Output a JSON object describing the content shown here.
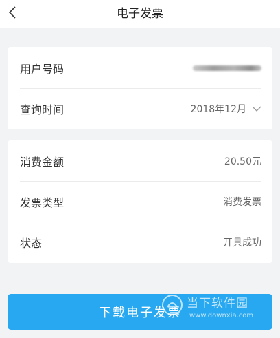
{
  "nav": {
    "title": "电子发票",
    "back_icon": "chevron-left-icon"
  },
  "query_card": {
    "user_number": {
      "label": "用户号码",
      "value_redacted": true
    },
    "query_time": {
      "label": "查询时间",
      "value": "2018年12月",
      "icon": "chevron-down-icon"
    }
  },
  "detail_card": {
    "amount": {
      "label": "消费金额",
      "value": "20.50元"
    },
    "invoice_type": {
      "label": "发票类型",
      "value": "消费发票"
    },
    "status": {
      "label": "状态",
      "value": "开具成功"
    }
  },
  "download_button": {
    "label": "下载电子发票"
  },
  "watermark": {
    "text": "当下软件园",
    "url": "www.downxia.com",
    "icon": "logo-icon"
  },
  "colors": {
    "primary_button": "#28a8f0",
    "background": "#f2f3f5",
    "card": "#ffffff"
  }
}
